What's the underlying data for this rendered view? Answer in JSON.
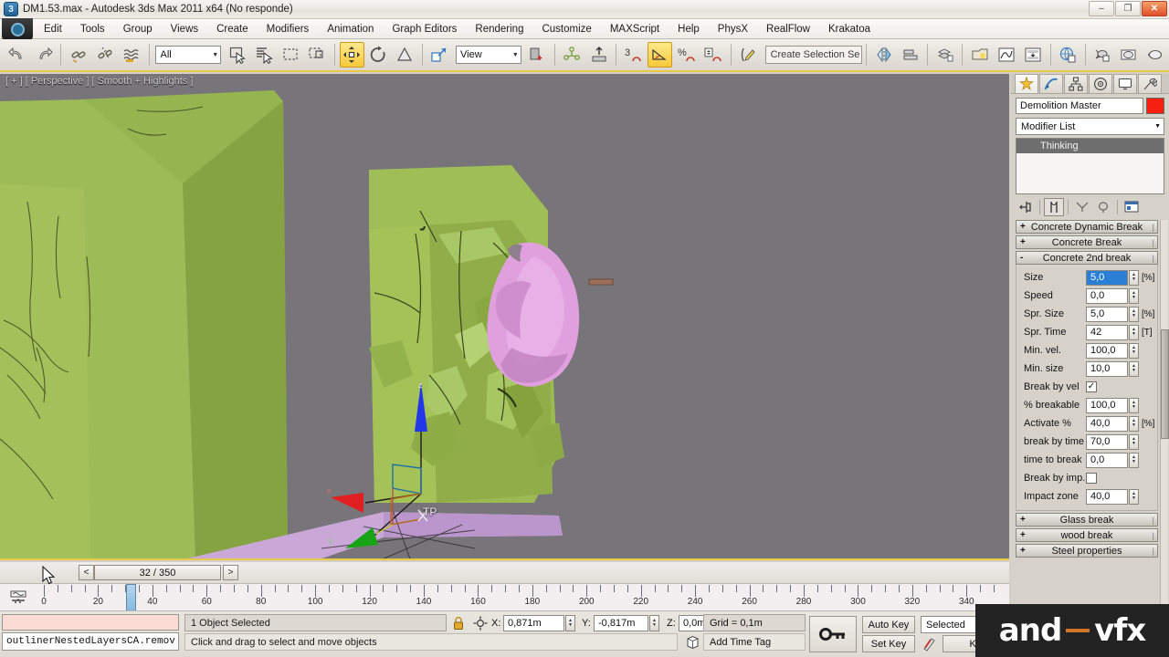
{
  "window": {
    "title": "DM1.53.max - Autodesk 3ds Max  2011 x64   (No responde)",
    "app_icon": "max-logo-icon",
    "buttons": {
      "minimize": "–",
      "maximize": "❐",
      "close": "✕"
    }
  },
  "menubar": {
    "items": [
      "Edit",
      "Tools",
      "Group",
      "Views",
      "Create",
      "Modifiers",
      "Animation",
      "Graph Editors",
      "Rendering",
      "Customize",
      "MAXScript",
      "Help",
      "PhysX",
      "RealFlow",
      "Krakatoa"
    ]
  },
  "toolbar": {
    "selection_filter": "All",
    "reference_coord": "View",
    "named_selection_placeholder": "Create Selection Se",
    "snap_count": "3",
    "percent_label": "%",
    "icons": [
      "undo-icon",
      "redo-icon",
      "select-link-icon",
      "unlink-icon",
      "bind-spacewarp-icon",
      "select-object-icon",
      "select-by-name-icon",
      "select-region-icon",
      "window-crossing-icon",
      "select-move-icon",
      "select-rotate-icon",
      "select-scale-icon",
      "reference-coordinate-icon",
      "use-pivot-center-icon",
      "select-manipulate-icon",
      "keyboard-shortcut-override-icon",
      "snap-toggle-icon",
      "angle-snap-icon",
      "percent-snap-icon",
      "spinner-snap-icon",
      "named-selection-sets-icon",
      "mirror-icon",
      "align-icon",
      "layer-manager-icon",
      "graphite-modeling-icon",
      "curve-editor-icon",
      "schematic-view-icon",
      "material-editor-icon",
      "render-setup-icon",
      "render-frame-icon",
      "render-production-icon"
    ]
  },
  "viewport": {
    "label": "[ + ] [ Perspective ] [ Smooth + Highlights ]",
    "gizmo": {
      "x_axis": "x",
      "y_axis": "y",
      "z_axis": "z",
      "object_label": "TP"
    },
    "colors": {
      "background": "#77757a",
      "wall_green": "#96b44f",
      "wall_green_dark": "#7e9c3c",
      "floor_purple": "#c9a8d8",
      "debris_pink": "#dfa0dd",
      "axis_x": "#e02020",
      "axis_y": "#17a417",
      "axis_z": "#2238e8"
    }
  },
  "timeslider": {
    "prev_label": "<",
    "next_label": ">",
    "frame_label": "32 / 350"
  },
  "trackbar": {
    "icon": "open-minieditor-icon",
    "tick_labels": [
      "0",
      "20",
      "40",
      "60",
      "80",
      "100",
      "120",
      "140",
      "160",
      "180",
      "200",
      "220",
      "240",
      "260",
      "280",
      "300",
      "320",
      "340"
    ],
    "current_frame": 32,
    "frame_range": [
      0,
      350
    ]
  },
  "statusbar": {
    "maxscript_listener_value": "",
    "maxscript_entry_value": "outlinerNestedLayersCA.remov",
    "selection_info": "1 Object Selected",
    "prompt": "Click and drag to select and move objects",
    "lock_icon": "lock-selection-icon",
    "absolute_mode_icon": "absolute-relative-transform-icon",
    "coords": [
      {
        "axis": "X:",
        "value": "0,871m"
      },
      {
        "axis": "Y:",
        "value": "-0,817m"
      },
      {
        "axis": "Z:",
        "value": "0,0m"
      }
    ],
    "grid_label": "Grid = 0,1m",
    "add_time_tag": "Add Time Tag",
    "time_tag_icon": "time-tag-icon",
    "key_mode_icon": "key-mode-toggle-icon",
    "auto_key": "Auto Key",
    "set_key": "Set Key",
    "key_filters": "Key Filters...",
    "key_selection": "Selected",
    "set_key_icon": "set-key-pencil-icon"
  },
  "command_panel": {
    "tabs": [
      {
        "name": "create-tab",
        "icon": "star-icon",
        "selected": true
      },
      {
        "name": "modify-tab",
        "icon": "curve-icon",
        "selected": false
      },
      {
        "name": "hierarchy-tab",
        "icon": "hierarchy-icon",
        "selected": false
      },
      {
        "name": "motion-tab",
        "icon": "wheel-icon",
        "selected": false
      },
      {
        "name": "display-tab",
        "icon": "monitor-icon",
        "selected": false
      },
      {
        "name": "utilities-tab",
        "icon": "hammer-icon",
        "selected": false
      }
    ],
    "object_name": "Demolition Master",
    "object_color": "#f41f0f",
    "modifier_list_label": "Modifier List",
    "modifier_stack": [
      {
        "label": "Thinking",
        "selected": true
      }
    ],
    "stack_tools": [
      "pin-stack-icon",
      "show-end-result-icon",
      "make-unique-icon",
      "remove-modifier-icon",
      "configure-modifier-sets-icon"
    ],
    "rollouts": [
      {
        "title": "Concrete Dynamic Break",
        "state": "+",
        "open": false
      },
      {
        "title": "Concrete Break",
        "state": "+",
        "open": false
      },
      {
        "title": "Concrete 2nd break",
        "state": "-",
        "open": true,
        "params": [
          {
            "label": "Size",
            "type": "spinner",
            "value": "5,0",
            "unit": "[%]",
            "highlight": true
          },
          {
            "label": "Speed",
            "type": "spinner",
            "value": "0,0",
            "unit": ""
          },
          {
            "label": "Spr. Size",
            "type": "spinner",
            "value": "5,0",
            "unit": "[%]"
          },
          {
            "label": "Spr. Time",
            "type": "spinner",
            "value": "42",
            "unit": "[T]"
          },
          {
            "label": "Min. vel.",
            "type": "spinner",
            "value": "100,0",
            "unit": ""
          },
          {
            "label": "Min. size",
            "type": "spinner",
            "value": "10,0",
            "unit": ""
          },
          {
            "label": "Break by vel",
            "type": "checkbox",
            "checked": true
          },
          {
            "label": "% breakable",
            "type": "spinner",
            "value": "100,0",
            "unit": ""
          },
          {
            "label": "Activate %",
            "type": "spinner",
            "value": "40,0",
            "unit": "[%]"
          },
          {
            "label": "break by time",
            "type": "spinner",
            "value": "70,0",
            "unit": ""
          },
          {
            "label": "time to break",
            "type": "spinner",
            "value": "0,0",
            "unit": ""
          },
          {
            "label": "Break by imp.",
            "type": "checkbox",
            "checked": false
          },
          {
            "label": "Impact zone",
            "type": "spinner",
            "value": "40,0",
            "unit": ""
          }
        ]
      },
      {
        "title": "Glass break",
        "state": "+",
        "open": false
      },
      {
        "title": "wood break",
        "state": "+",
        "open": false
      },
      {
        "title": "Steel properties",
        "state": "+",
        "open": false
      }
    ]
  },
  "watermark": {
    "text_a": "and",
    "text_b": "vfx"
  }
}
